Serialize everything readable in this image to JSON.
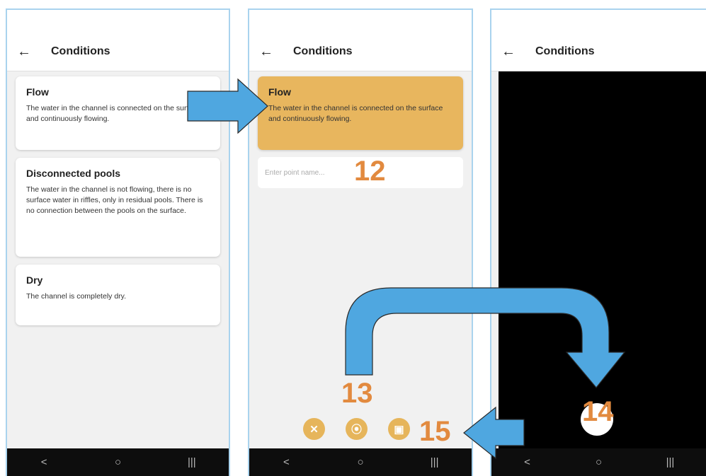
{
  "screens": [
    {
      "title": "Conditions",
      "cards": [
        {
          "title": "Flow",
          "text": "The water in the channel is connected on the surface and continuously flowing."
        },
        {
          "title": "Disconnected pools",
          "text": "The water in the channel is not flowing, there is no surface water in riffles, only in residual pools. There is no connection between the pools on the surface."
        },
        {
          "title": "Dry",
          "text": "The channel is completely dry."
        }
      ]
    },
    {
      "title": "Conditions",
      "selected_card": {
        "title": "Flow",
        "text": "The water in the channel is connected on the surface and continuously flowing."
      },
      "point_name_placeholder": "Enter point name...",
      "buttons": {
        "cancel": "✕",
        "capture": "⦿",
        "save": "▣"
      }
    },
    {
      "title": "Conditions"
    }
  ],
  "nav": {
    "back": "<",
    "home": "○",
    "recent": "|||"
  },
  "icons": {
    "back": "←"
  },
  "annotations": {
    "step12": "12",
    "step13": "13",
    "step14": "14",
    "step15": "15"
  },
  "colors": {
    "accent": "#e8b65e",
    "annotation": "#e28a3f",
    "arrow": "#4fa7e0"
  }
}
